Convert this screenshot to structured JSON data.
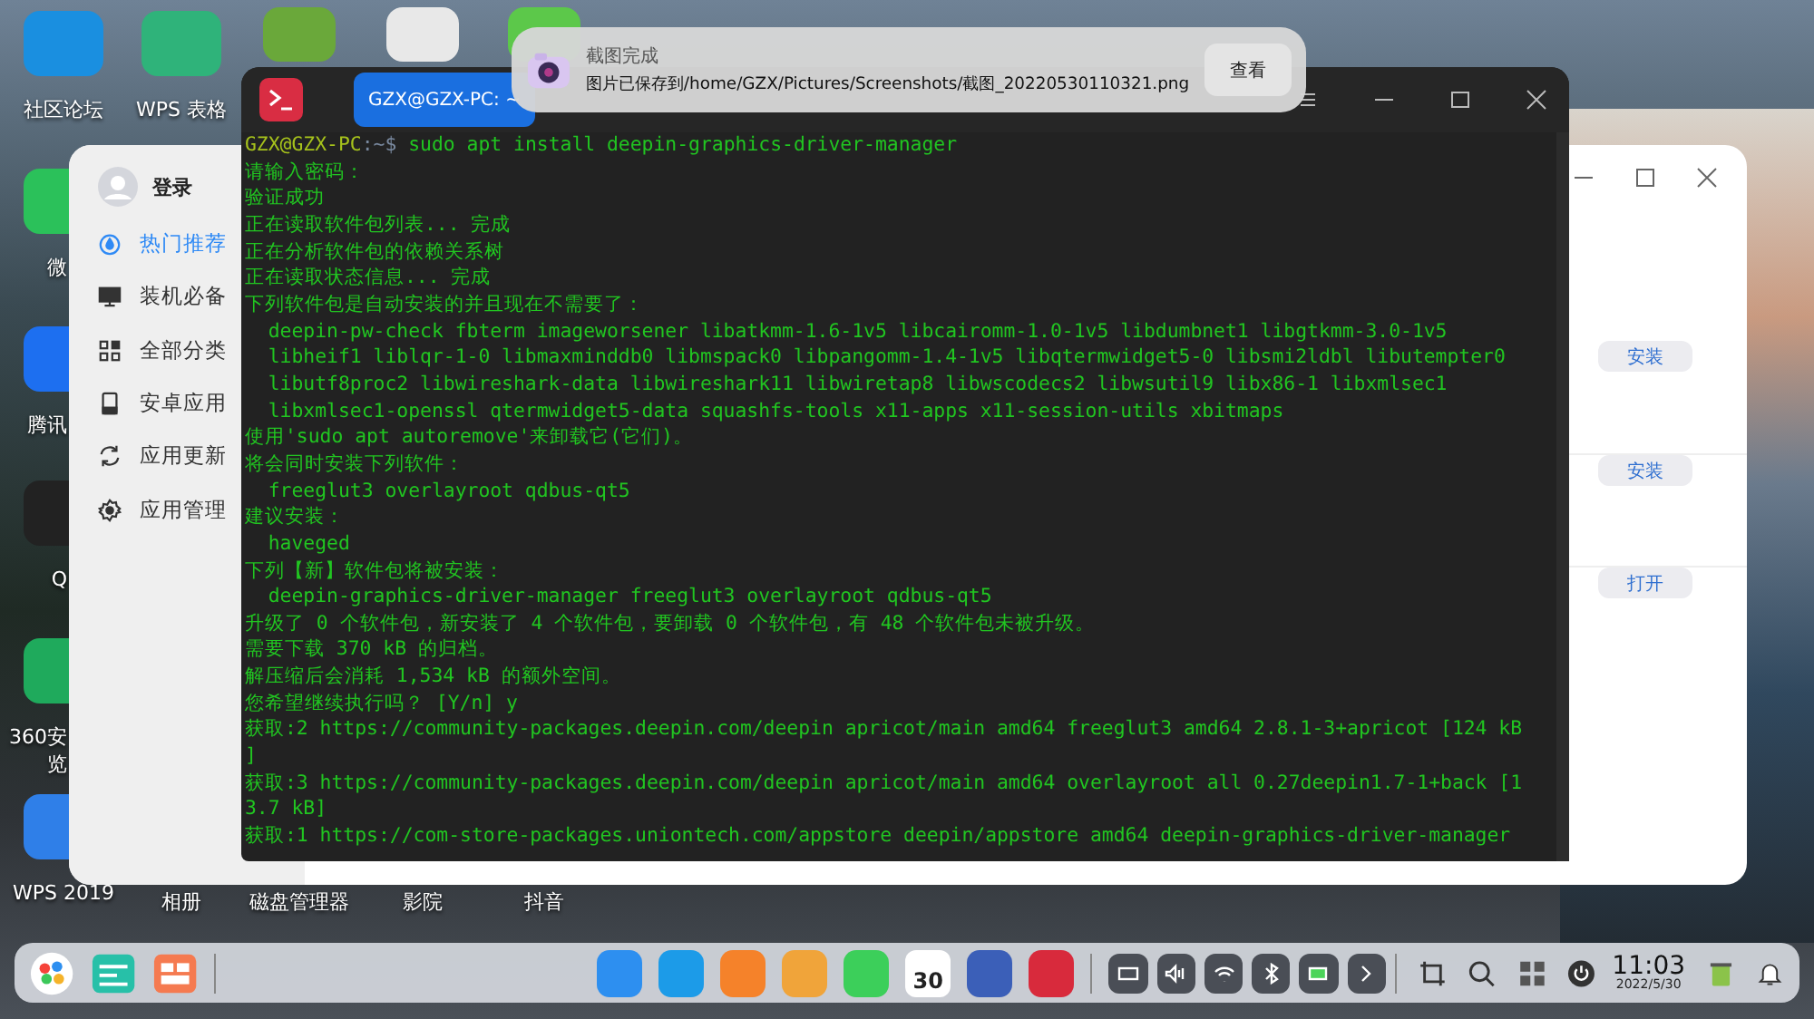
{
  "desktop": {
    "icons": [
      {
        "lines": [
          "社区论坛"
        ]
      },
      {
        "lines": [
          "WPS 表格"
        ]
      },
      {
        "lines": [
          "微"
        ]
      },
      {
        "lines": [
          "腾讯"
        ]
      },
      {
        "lines": [
          "Q"
        ]
      },
      {
        "lines": [
          "360安",
          "览"
        ]
      },
      {
        "lines": [
          "WPS 2019"
        ]
      },
      {
        "lines": [
          "相册"
        ]
      },
      {
        "lines": [
          "磁盘管理器"
        ]
      },
      {
        "lines": [
          "影院"
        ]
      },
      {
        "lines": [
          "抖音"
        ]
      }
    ]
  },
  "app_store": {
    "login": "登录",
    "nav": [
      {
        "label": "热门推荐",
        "selected": true
      },
      {
        "label": "装机必备",
        "selected": false
      },
      {
        "label": "全部分类",
        "selected": false
      },
      {
        "label": "安卓应用",
        "selected": false
      },
      {
        "label": "应用更新",
        "selected": false
      },
      {
        "label": "应用管理",
        "selected": false
      }
    ],
    "actions": [
      "安装",
      "安装",
      "打开"
    ]
  },
  "terminal": {
    "tab": "GZX@GZX-PC: ~",
    "prompt": {
      "user": "GZX@GZX-PC",
      "path": ":~$",
      "command": " sudo apt install deepin-graphics-driver-manager"
    },
    "lines": [
      "请输入密码：",
      "验证成功",
      "正在读取软件包列表... 完成",
      "正在分析软件包的依赖关系树",
      "正在读取状态信息... 完成",
      "下列软件包是自动安装的并且现在不需要了：",
      "  deepin-pw-check fbterm imageworsener libatkmm-1.6-1v5 libcairomm-1.0-1v5 libdumbnet1 libgtkmm-3.0-1v5",
      "  libheif1 liblqr-1-0 libmaxminddb0 libmspack0 libpangomm-1.4-1v5 libqtermwidget5-0 libsmi2ldbl libutempter0",
      "  libutf8proc2 libwireshark-data libwireshark11 libwiretap8 libwscodecs2 libwsutil9 libx86-1 libxmlsec1",
      "  libxmlsec1-openssl qtermwidget5-data squashfs-tools x11-apps x11-session-utils xbitmaps",
      "使用'sudo apt autoremove'来卸载它(它们)。",
      "将会同时安装下列软件：",
      "  freeglut3 overlayroot qdbus-qt5",
      "建议安装：",
      "  haveged",
      "下列【新】软件包将被安装：",
      "  deepin-graphics-driver-manager freeglut3 overlayroot qdbus-qt5",
      "升级了 0 个软件包，新安装了 4 个软件包，要卸载 0 个软件包，有 48 个软件包未被升级。",
      "需要下载 370 kB 的归档。",
      "解压缩后会消耗 1,534 kB 的额外空间。",
      "您希望继续执行吗？ [Y/n] y",
      "获取:2 https://community-packages.deepin.com/deepin apricot/main amd64 freeglut3 amd64 2.8.1-3+apricot [124 kB",
      "]",
      "获取:3 https://community-packages.deepin.com/deepin apricot/main amd64 overlayroot all 0.27deepin1.7-1+back [1",
      "3.7 kB]",
      "获取:1 https://com-store-packages.uniontech.com/appstore deepin/appstore amd64 deepin-graphics-driver-manager"
    ]
  },
  "notification": {
    "title": "截图完成",
    "body": "图片已保存到/home/GZX/Pictures/Screenshots/截图_20220530110321.png",
    "button": "查看"
  },
  "dock": {
    "calendar_day": "30",
    "time": "11:03",
    "date": "2022/5/30"
  }
}
